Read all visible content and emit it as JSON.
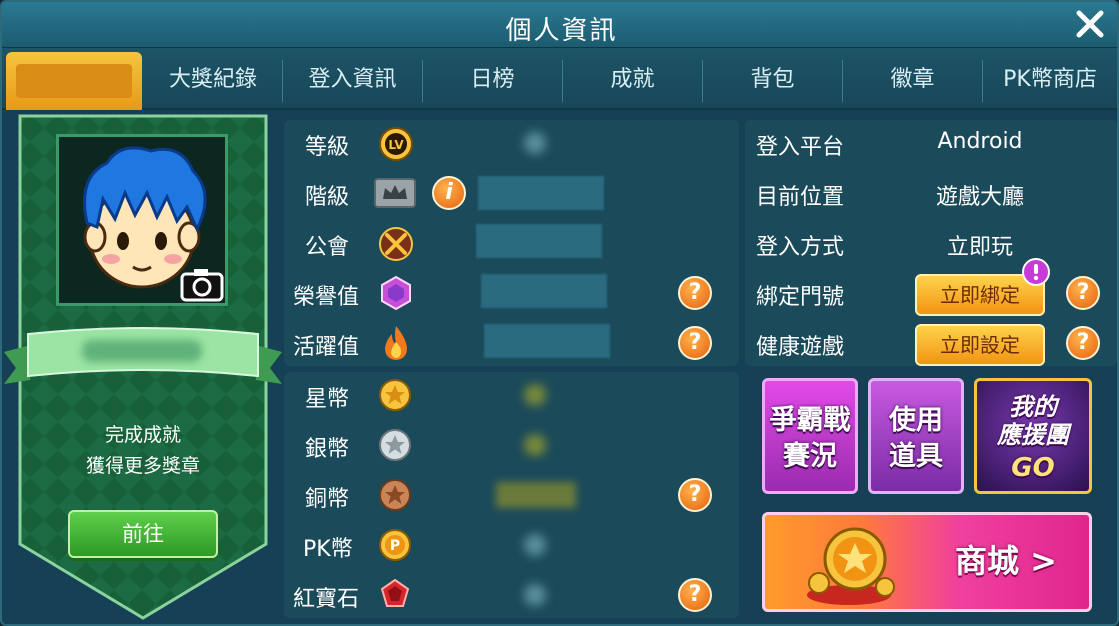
{
  "window": {
    "title": "個人資訊",
    "close_icon": "close-icon"
  },
  "tabs": [
    {
      "label": ""
    },
    {
      "label": "大獎紀錄"
    },
    {
      "label": "登入資訊"
    },
    {
      "label": "日榜"
    },
    {
      "label": "成就"
    },
    {
      "label": "背包"
    },
    {
      "label": "徽章"
    },
    {
      "label": "PK幣商店"
    }
  ],
  "profile_card": {
    "promo_line1": "完成成就",
    "promo_line2": "獲得更多獎章",
    "goto_label": "前往"
  },
  "stats": [
    {
      "label": "等級",
      "icon": "level-badge-icon"
    },
    {
      "label": "階級",
      "icon": "crown-icon",
      "info_icon": "info-icon"
    },
    {
      "label": "公會",
      "icon": "guild-swords-icon"
    },
    {
      "label": "榮譽值",
      "icon": "honor-gem-icon"
    },
    {
      "label": "活躍值",
      "icon": "flame-icon"
    }
  ],
  "currencies": [
    {
      "label": "星幣",
      "icon": "star-coin-icon"
    },
    {
      "label": "銀幣",
      "icon": "silver-coin-icon"
    },
    {
      "label": "銅幣",
      "icon": "copper-coin-icon"
    },
    {
      "label": "PK幣",
      "icon": "pk-coin-icon"
    },
    {
      "label": "紅寶石",
      "icon": "ruby-icon"
    }
  ],
  "login_info": {
    "platform_label": "登入平台",
    "platform_value": "Android",
    "location_label": "目前位置",
    "location_value": "遊戲大廳",
    "method_label": "登入方式",
    "method_value": "立即玩",
    "bind_label": "綁定門號",
    "bind_button": "立即綁定",
    "health_label": "健康遊戲",
    "health_button": "立即設定"
  },
  "tiles": {
    "battle_line1": "爭霸戰",
    "battle_line2": "賽況",
    "use_line1": "使用",
    "use_line2": "道具",
    "support_line1": "我的",
    "support_line2": "應援團",
    "support_line3": "GO",
    "shop_label": "商城 >"
  },
  "colors": {
    "accent_gold": "#f2a71b",
    "panel": "#1b4a5a",
    "help_orange": "#e5610e",
    "tile_purple": "#b22fc6",
    "shop_pink": "#e62a9a"
  }
}
